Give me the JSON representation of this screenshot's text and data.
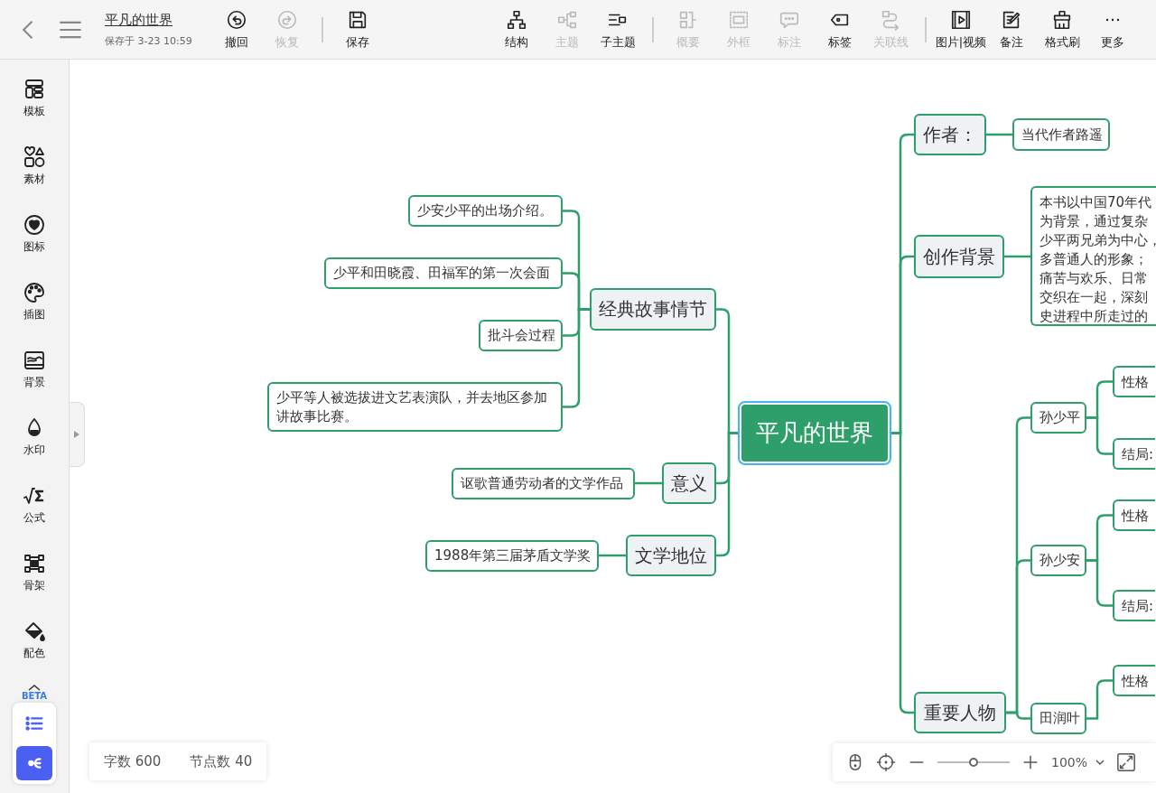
{
  "header": {
    "title": "平凡的世界",
    "saved": "保存于 3-23 10:59",
    "groups": [
      [
        {
          "label": "撤回",
          "disabled": false
        },
        {
          "label": "恢复",
          "disabled": true
        }
      ],
      [
        {
          "label": "保存",
          "disabled": false
        }
      ],
      [
        {
          "label": "结构",
          "disabled": false
        },
        {
          "label": "主题",
          "disabled": true
        },
        {
          "label": "子主题",
          "disabled": false
        }
      ],
      [
        {
          "label": "概要",
          "disabled": true
        },
        {
          "label": "外框",
          "disabled": true
        },
        {
          "label": "标注",
          "disabled": true
        },
        {
          "label": "标签",
          "disabled": false
        },
        {
          "label": "关联线",
          "disabled": true
        }
      ],
      [
        {
          "label": "图片|视频",
          "disabled": false
        },
        {
          "label": "备注",
          "disabled": false
        },
        {
          "label": "格式刷",
          "disabled": false
        },
        {
          "label": "更多",
          "disabled": false
        }
      ]
    ]
  },
  "sidebar": {
    "items": [
      {
        "label": "模板"
      },
      {
        "label": "素材"
      },
      {
        "label": "图标"
      },
      {
        "label": "插图"
      },
      {
        "label": "背景"
      },
      {
        "label": "水印"
      },
      {
        "label": "公式"
      },
      {
        "label": "骨架"
      },
      {
        "label": "配色"
      }
    ],
    "beta": "BETA",
    "views": [
      {
        "selected": false
      },
      {
        "selected": true
      }
    ]
  },
  "mind_map": {
    "root": {
      "text": "平凡的世界",
      "selected": true,
      "children": [
        {
          "text": "作者：",
          "children": [
            {
              "text": "当代作者路遥"
            }
          ]
        },
        {
          "text": "创作背景",
          "children": [
            {
              "lines": [
                "本书以中国70年代",
                "为背景，通过复杂",
                "少平两兄弟为中心，",
                "多普通人的形象；",
                "痛苦与欢乐、日常",
                "交织在一起，深刻",
                "史进程中所走过的"
              ]
            }
          ]
        },
        {
          "text": "重要人物",
          "children": [
            {
              "text": "孙少平",
              "children": [
                {
                  "text": "性格"
                },
                {
                  "text": "结局:"
                }
              ]
            },
            {
              "text": "孙少安",
              "children": [
                {
                  "text": "性格"
                },
                {
                  "text": "结局:"
                }
              ]
            },
            {
              "text": "田润叶",
              "children": [
                {
                  "text": "性格"
                }
              ]
            }
          ]
        },
        {
          "text": "经典故事情节",
          "children": [
            {
              "text": "少安少平的出场介绍。"
            },
            {
              "text": "少平和田晓霞、田福军的第一次会面"
            },
            {
              "text": "批斗会过程"
            },
            {
              "text": "少平等人被选拔进文艺表演队，并去地区参加讲故事比赛。"
            }
          ]
        },
        {
          "text": "意义",
          "children": [
            {
              "text": "讴歌普通劳动者的文学作品"
            }
          ]
        },
        {
          "text": "文学地位",
          "children": [
            {
              "text": "1988年第三届茅盾文学奖"
            }
          ]
        }
      ]
    }
  },
  "stats": [
    {
      "label": "字数 600"
    },
    {
      "label": "节点数 40"
    }
  ],
  "zoom": {
    "level": 0.5,
    "value": "100%"
  }
}
